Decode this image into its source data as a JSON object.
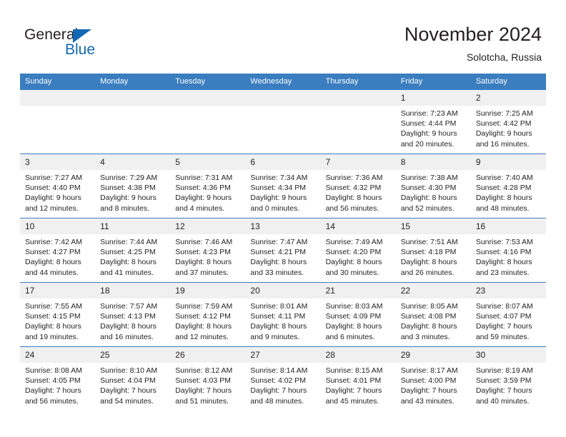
{
  "brand": {
    "name_part1": "General",
    "name_part2": "Blue",
    "accent_color": "#1268b3"
  },
  "header": {
    "title": "November 2024",
    "subtitle": "Solotcha, Russia"
  },
  "theme": {
    "header_row_bg": "#3a7ebf",
    "daynum_bg": "#f0f0f0",
    "text_color": "#231f20"
  },
  "weekday_headers": [
    "Sunday",
    "Monday",
    "Tuesday",
    "Wednesday",
    "Thursday",
    "Friday",
    "Saturday"
  ],
  "weeks": [
    [
      {
        "day": "",
        "empty": true
      },
      {
        "day": "",
        "empty": true
      },
      {
        "day": "",
        "empty": true
      },
      {
        "day": "",
        "empty": true
      },
      {
        "day": "",
        "empty": true
      },
      {
        "day": "1",
        "sunrise": "Sunrise: 7:23 AM",
        "sunset": "Sunset: 4:44 PM",
        "daylight": "Daylight: 9 hours and 20 minutes."
      },
      {
        "day": "2",
        "sunrise": "Sunrise: 7:25 AM",
        "sunset": "Sunset: 4:42 PM",
        "daylight": "Daylight: 9 hours and 16 minutes."
      }
    ],
    [
      {
        "day": "3",
        "sunrise": "Sunrise: 7:27 AM",
        "sunset": "Sunset: 4:40 PM",
        "daylight": "Daylight: 9 hours and 12 minutes."
      },
      {
        "day": "4",
        "sunrise": "Sunrise: 7:29 AM",
        "sunset": "Sunset: 4:38 PM",
        "daylight": "Daylight: 9 hours and 8 minutes."
      },
      {
        "day": "5",
        "sunrise": "Sunrise: 7:31 AM",
        "sunset": "Sunset: 4:36 PM",
        "daylight": "Daylight: 9 hours and 4 minutes."
      },
      {
        "day": "6",
        "sunrise": "Sunrise: 7:34 AM",
        "sunset": "Sunset: 4:34 PM",
        "daylight": "Daylight: 9 hours and 0 minutes."
      },
      {
        "day": "7",
        "sunrise": "Sunrise: 7:36 AM",
        "sunset": "Sunset: 4:32 PM",
        "daylight": "Daylight: 8 hours and 56 minutes."
      },
      {
        "day": "8",
        "sunrise": "Sunrise: 7:38 AM",
        "sunset": "Sunset: 4:30 PM",
        "daylight": "Daylight: 8 hours and 52 minutes."
      },
      {
        "day": "9",
        "sunrise": "Sunrise: 7:40 AM",
        "sunset": "Sunset: 4:28 PM",
        "daylight": "Daylight: 8 hours and 48 minutes."
      }
    ],
    [
      {
        "day": "10",
        "sunrise": "Sunrise: 7:42 AM",
        "sunset": "Sunset: 4:27 PM",
        "daylight": "Daylight: 8 hours and 44 minutes."
      },
      {
        "day": "11",
        "sunrise": "Sunrise: 7:44 AM",
        "sunset": "Sunset: 4:25 PM",
        "daylight": "Daylight: 8 hours and 41 minutes."
      },
      {
        "day": "12",
        "sunrise": "Sunrise: 7:46 AM",
        "sunset": "Sunset: 4:23 PM",
        "daylight": "Daylight: 8 hours and 37 minutes."
      },
      {
        "day": "13",
        "sunrise": "Sunrise: 7:47 AM",
        "sunset": "Sunset: 4:21 PM",
        "daylight": "Daylight: 8 hours and 33 minutes."
      },
      {
        "day": "14",
        "sunrise": "Sunrise: 7:49 AM",
        "sunset": "Sunset: 4:20 PM",
        "daylight": "Daylight: 8 hours and 30 minutes."
      },
      {
        "day": "15",
        "sunrise": "Sunrise: 7:51 AM",
        "sunset": "Sunset: 4:18 PM",
        "daylight": "Daylight: 8 hours and 26 minutes."
      },
      {
        "day": "16",
        "sunrise": "Sunrise: 7:53 AM",
        "sunset": "Sunset: 4:16 PM",
        "daylight": "Daylight: 8 hours and 23 minutes."
      }
    ],
    [
      {
        "day": "17",
        "sunrise": "Sunrise: 7:55 AM",
        "sunset": "Sunset: 4:15 PM",
        "daylight": "Daylight: 8 hours and 19 minutes."
      },
      {
        "day": "18",
        "sunrise": "Sunrise: 7:57 AM",
        "sunset": "Sunset: 4:13 PM",
        "daylight": "Daylight: 8 hours and 16 minutes."
      },
      {
        "day": "19",
        "sunrise": "Sunrise: 7:59 AM",
        "sunset": "Sunset: 4:12 PM",
        "daylight": "Daylight: 8 hours and 12 minutes."
      },
      {
        "day": "20",
        "sunrise": "Sunrise: 8:01 AM",
        "sunset": "Sunset: 4:11 PM",
        "daylight": "Daylight: 8 hours and 9 minutes."
      },
      {
        "day": "21",
        "sunrise": "Sunrise: 8:03 AM",
        "sunset": "Sunset: 4:09 PM",
        "daylight": "Daylight: 8 hours and 6 minutes."
      },
      {
        "day": "22",
        "sunrise": "Sunrise: 8:05 AM",
        "sunset": "Sunset: 4:08 PM",
        "daylight": "Daylight: 8 hours and 3 minutes."
      },
      {
        "day": "23",
        "sunrise": "Sunrise: 8:07 AM",
        "sunset": "Sunset: 4:07 PM",
        "daylight": "Daylight: 7 hours and 59 minutes."
      }
    ],
    [
      {
        "day": "24",
        "sunrise": "Sunrise: 8:08 AM",
        "sunset": "Sunset: 4:05 PM",
        "daylight": "Daylight: 7 hours and 56 minutes."
      },
      {
        "day": "25",
        "sunrise": "Sunrise: 8:10 AM",
        "sunset": "Sunset: 4:04 PM",
        "daylight": "Daylight: 7 hours and 54 minutes."
      },
      {
        "day": "26",
        "sunrise": "Sunrise: 8:12 AM",
        "sunset": "Sunset: 4:03 PM",
        "daylight": "Daylight: 7 hours and 51 minutes."
      },
      {
        "day": "27",
        "sunrise": "Sunrise: 8:14 AM",
        "sunset": "Sunset: 4:02 PM",
        "daylight": "Daylight: 7 hours and 48 minutes."
      },
      {
        "day": "28",
        "sunrise": "Sunrise: 8:15 AM",
        "sunset": "Sunset: 4:01 PM",
        "daylight": "Daylight: 7 hours and 45 minutes."
      },
      {
        "day": "29",
        "sunrise": "Sunrise: 8:17 AM",
        "sunset": "Sunset: 4:00 PM",
        "daylight": "Daylight: 7 hours and 43 minutes."
      },
      {
        "day": "30",
        "sunrise": "Sunrise: 8:19 AM",
        "sunset": "Sunset: 3:59 PM",
        "daylight": "Daylight: 7 hours and 40 minutes."
      }
    ]
  ]
}
